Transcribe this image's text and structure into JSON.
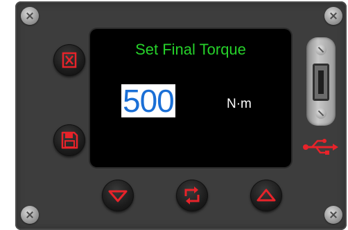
{
  "screen": {
    "title": "Set Final Torque",
    "value": "500",
    "unit": "N·m"
  },
  "buttons": {
    "cancel": {
      "icon": "x-box-icon"
    },
    "save": {
      "icon": "floppy-disk-icon"
    },
    "decrease": {
      "icon": "triangle-down-icon"
    },
    "cycle": {
      "icon": "cycle-arrows-icon"
    },
    "increase": {
      "icon": "triangle-up-icon"
    }
  },
  "usb": {
    "icon": "usb-icon"
  },
  "colors": {
    "panel": "#3d3d3d",
    "title_text": "#26d12a",
    "value_text": "#1a6fd6",
    "value_highlight": "#ffffff",
    "icon_red": "#e8232a"
  }
}
